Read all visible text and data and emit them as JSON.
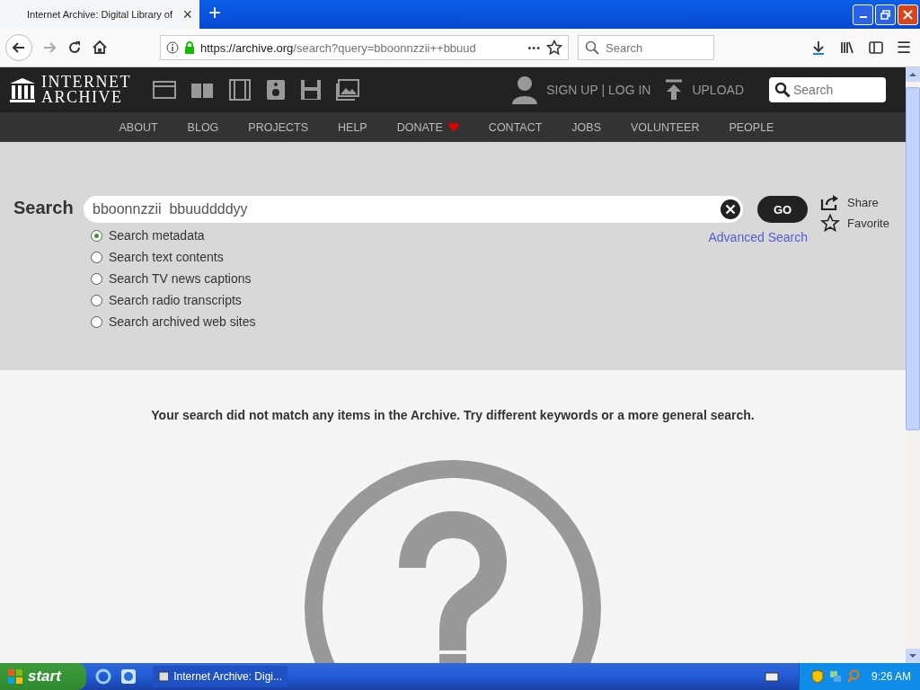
{
  "browser": {
    "tab_title": "Internet Archive: Digital Library of",
    "tab_close": "×",
    "new_tab": "+",
    "url_host": "https://archive.org",
    "url_path": "/search?query=bboonnzzii++bbuud",
    "menu_dots": "•••",
    "search": {
      "placeholder": "Search"
    },
    "hamburger": "☰"
  },
  "site": {
    "logo_line1": "INTERNET",
    "logo_line2": "ARCHIVE",
    "auth": "SIGN UP | LOG IN",
    "upload": "UPLOAD",
    "search": {
      "placeholder": "Search"
    },
    "nav": [
      {
        "label": "ABOUT",
        "heart": false
      },
      {
        "label": "BLOG",
        "heart": false
      },
      {
        "label": "PROJECTS",
        "heart": false
      },
      {
        "label": "HELP",
        "heart": false
      },
      {
        "label": "DONATE",
        "heart": true
      },
      {
        "label": "CONTACT",
        "heart": false
      },
      {
        "label": "JOBS",
        "heart": false
      },
      {
        "label": "VOLUNTEER",
        "heart": false
      },
      {
        "label": "PEOPLE",
        "heart": false
      }
    ]
  },
  "search_panel": {
    "heading": "Search",
    "query": "bboonnzzii  bbuuddddyy",
    "go": "GO",
    "advanced": "Advanced Search",
    "share": "Share",
    "favorite": "Favorite",
    "options": [
      {
        "label": "Search metadata",
        "selected": true
      },
      {
        "label": "Search text contents",
        "selected": false
      },
      {
        "label": "Search TV news captions",
        "selected": false
      },
      {
        "label": "Search radio transcripts",
        "selected": false
      },
      {
        "label": "Search archived web sites",
        "selected": false
      }
    ]
  },
  "message": "Your search did not match any items in the Archive. Try different keywords or a more general search.",
  "taskbar": {
    "start": "start",
    "task": "Internet Archive: Digi...",
    "time": "9:26 AM"
  }
}
